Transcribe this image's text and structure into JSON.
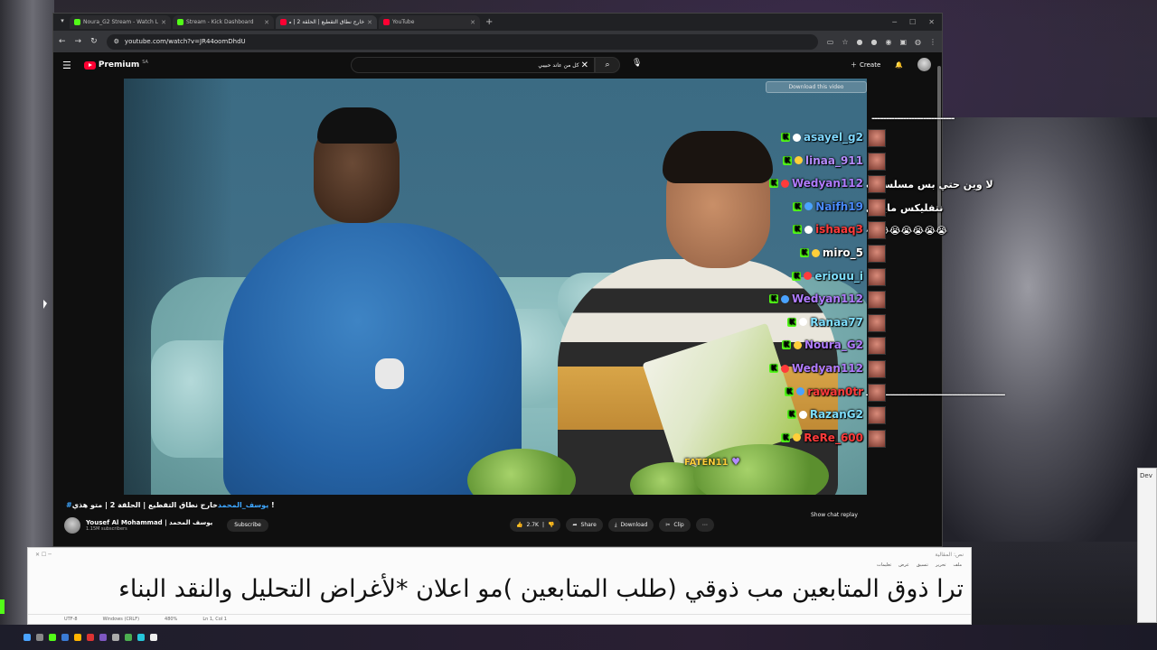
{
  "tabs": [
    {
      "label": "Noura_G2 Stream - Watch Live",
      "color": "#53fc18",
      "active": false
    },
    {
      "label": "Stream - Kick Dashboard",
      "color": "#53fc18",
      "active": false
    },
    {
      "label": "خارج نطاق التقطيع | الحلقة 2 | مت...",
      "color": "#ff0033",
      "active": true
    },
    {
      "label": "YouTube",
      "color": "#ff0033",
      "active": false
    }
  ],
  "address": "youtube.com/watch?v=JR44oomDhdU",
  "youtube": {
    "brand": "Premium",
    "region": "SA",
    "search_value": "كل من عاند حبيبي",
    "create_label": "Create",
    "download_badge": "Download this video"
  },
  "video": {
    "title_tag": "#يوسف_المحمد",
    "title_text": "خارج نطاق التقطيع | الحلقة 2 | متو هذي !",
    "channel": "Yousef Al Mohammad | يوسف المحمد",
    "subscribers": "1.15M subscribers",
    "subscribe_label": "Subscribe",
    "likes": "2.7K",
    "share_label": "Share",
    "download_label": "Download",
    "clip_label": "Clip",
    "show_chat_label": "Show chat replay",
    "overlay_user": "FATEN11"
  },
  "chat": [
    {
      "user": "asayel_g2",
      "color": "#7fd8ff"
    },
    {
      "user": "linaa_911",
      "color": "#b58cff"
    },
    {
      "user": "Wedyan112",
      "color": "#b07cff"
    },
    {
      "user": "Naifh19",
      "color": "#4a8cff"
    },
    {
      "user": "ishaaq3",
      "color": "#ff3b3b"
    },
    {
      "user": "miro_5",
      "color": "#ffffff"
    },
    {
      "user": "eriouu_i",
      "color": "#7fe0ff"
    },
    {
      "user": "Wedyan112",
      "color": "#b07cff"
    },
    {
      "user": "Ranaa77",
      "color": "#7fe0ff"
    },
    {
      "user": "Noura_G2",
      "color": "#b07cff"
    },
    {
      "user": "Wedyan112",
      "color": "#b07cff"
    },
    {
      "user": "rawan0tr",
      "color": "#ff3b3b"
    },
    {
      "user": "RazanG2",
      "color": "#7fe0ff"
    },
    {
      "user": "ReRe_600",
      "color": "#ff3b3b"
    }
  ],
  "chat_messages": {
    "m1": "لا وين حتي بس مسلسلات",
    "m2": "نتفليكس مايفي",
    "m3": "😭😭😭😭😭😭😭",
    "dashes_top": "-----------------------------",
    "dashes_bottom": "ـــــــــــــــــــــــــــــــــــــــــــــ"
  },
  "editor": {
    "title": "نص: المقالية",
    "menu": [
      "ملف",
      "تحرير",
      "تنسيق",
      "عرض",
      "تعليمات"
    ],
    "text": "ترا ذوق المتابعين مب ذوقي (طلب المتابعين )مو اعلان *لأغراض التحليل والنقد البناء",
    "status": [
      "UTF-8",
      "Windows (CRLF)",
      "480%",
      "Ln 1, Col 1"
    ]
  }
}
